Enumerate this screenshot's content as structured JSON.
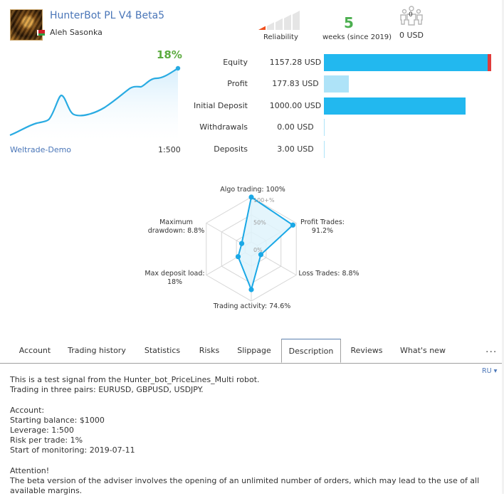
{
  "header": {
    "title": "HunterBot PL V4 Beta5",
    "author": "Aleh Sasonka",
    "country_flag": "belarus-flag",
    "reliability_label": "Reliability",
    "reliability_level": 1,
    "reliability_max": 5,
    "weeks_value": "5",
    "weeks_label": "weeks (since 2019)",
    "subscribers_count": "0",
    "subscribers_fee": "0 USD"
  },
  "growth_chart": {
    "growth_percent": "18%",
    "broker": "Weltrade-Demo",
    "leverage": "1:500",
    "colors": {
      "line": "#29abe2",
      "value": "#5cab3f"
    }
  },
  "metrics": [
    {
      "label": "Equity",
      "value": "1157.28 USD",
      "amount": 1157.28,
      "style": "strong",
      "drawdown_marker": true
    },
    {
      "label": "Profit",
      "value": "177.83 USD",
      "amount": 177.83,
      "style": "light"
    },
    {
      "label": "Initial Deposit",
      "value": "1000.00 USD",
      "amount": 1000.0,
      "style": "strong"
    },
    {
      "label": "Withdrawals",
      "value": "0.00 USD",
      "amount": 0.0,
      "style": "thin"
    },
    {
      "label": "Deposits",
      "value": "3.00 USD",
      "amount": 3.0,
      "style": "thin"
    }
  ],
  "chart_data": {
    "type": "radar",
    "axes": [
      {
        "name": "Algo trading",
        "label": "Algo trading: 100%",
        "value": 100
      },
      {
        "name": "Profit Trades",
        "label": "Profit Trades:\n91.2%",
        "value": 91.2
      },
      {
        "name": "Loss Trades",
        "label": "Loss Trades: 8.8%",
        "value": 8.8
      },
      {
        "name": "Trading activity",
        "label": "Trading activity: 74.6%",
        "value": 74.6
      },
      {
        "name": "Max deposit load",
        "label": "Max deposit load:\n18%",
        "value": 18
      },
      {
        "name": "Maximum drawdown",
        "label": "Maximum\ndrawdown: 8.8%",
        "value": 8.8
      }
    ],
    "scale_labels": [
      "0%",
      "50%",
      "100+%"
    ],
    "range": [
      0,
      100
    ],
    "colors": {
      "line": "#1aa8e6",
      "fill": "#dff3fc",
      "grid": "#d6d6d6"
    }
  },
  "tabs": [
    {
      "label": "Account",
      "active": false
    },
    {
      "label": "Trading history",
      "active": false
    },
    {
      "label": "Statistics",
      "active": false
    },
    {
      "label": "Risks",
      "active": false
    },
    {
      "label": "Slippage",
      "active": false
    },
    {
      "label": "Description",
      "active": true
    },
    {
      "label": "Reviews",
      "active": false
    },
    {
      "label": "What's new",
      "active": false
    }
  ],
  "tabs_more": "···",
  "language": "RU ▾",
  "description": {
    "lines": [
      "This is a test signal from the Hunter_bot_PriceLines_Multi robot.",
      "Trading in three pairs: EURUSD, GBPUSD, USDJPY.",
      "",
      "Account:",
      "Starting balance: $1000",
      "Leverage: 1:500",
      "Risk per trade: 1%",
      "Start of monitoring: 2019-07-11",
      "",
      "Attention!",
      "The beta version of the adviser involves the opening of an unlimited number of orders, which may lead to the use of all available margins."
    ]
  }
}
